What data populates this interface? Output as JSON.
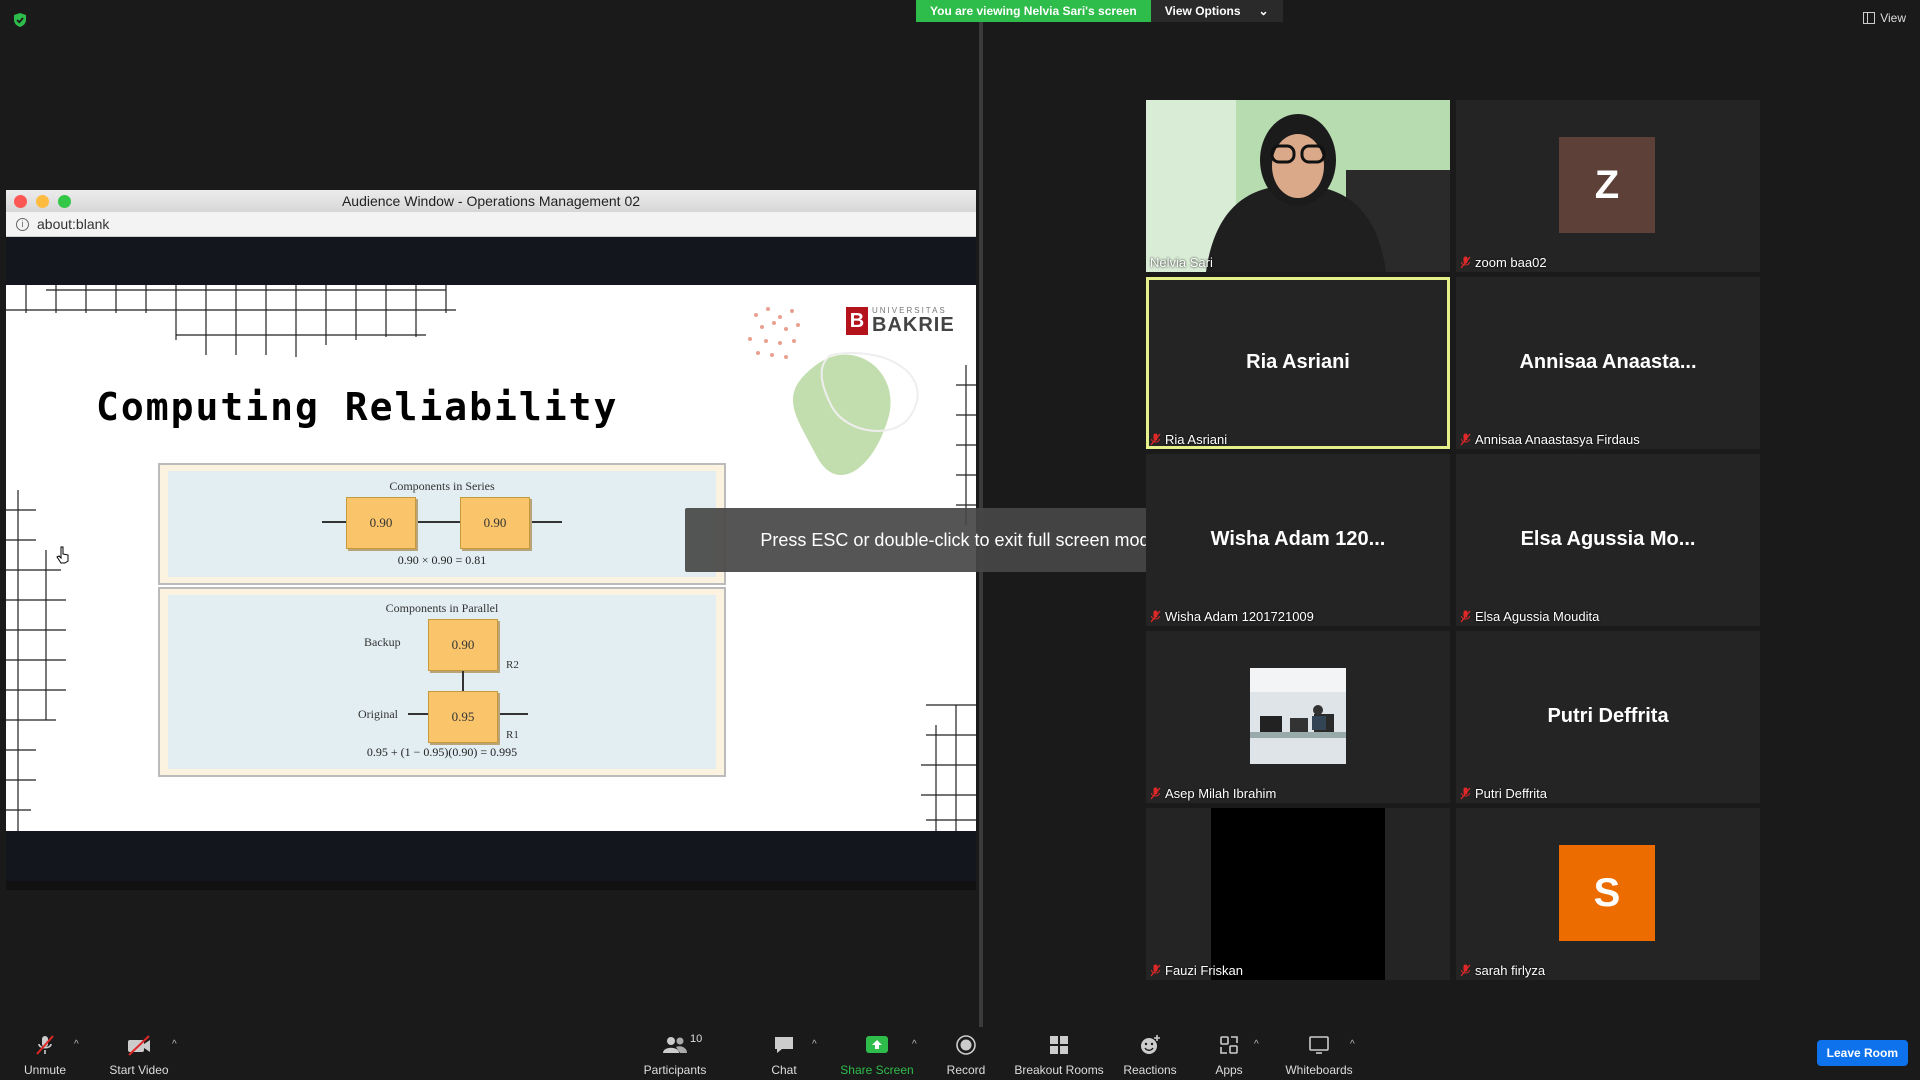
{
  "top": {
    "banner_text": "You are viewing Nelvia Sari's screen",
    "view_options_label": "View Options",
    "view_label": "View"
  },
  "audience_window": {
    "title": "Audience Window - Operations Management 02",
    "url": "about:blank"
  },
  "slide": {
    "title": "Computing Reliability",
    "logo_small": "UNIVERSITAS",
    "logo_big": "BAKRIE",
    "series": {
      "title": "Components in Series",
      "component_1": "0.90",
      "component_2": "0.90",
      "formula": "0.90 × 0.90 = 0.81"
    },
    "parallel": {
      "title": "Components in Parallel",
      "backup_label": "Backup",
      "backup_value": "0.90",
      "backup_r": "R2",
      "original_label": "Original",
      "original_value": "0.95",
      "original_r": "R1",
      "formula": "0.95 + (1 − 0.95)(0.90) = 0.995"
    }
  },
  "esc_toast": "Press ESC or double-click to exit full screen mode",
  "participants": [
    {
      "name": "Nelvia Sari",
      "display": "",
      "type": "video"
    },
    {
      "name": "zoom baa02",
      "display": "Z",
      "type": "avatar",
      "color": "#5d4037"
    },
    {
      "name": "Ria Asriani",
      "display": "Ria Asriani",
      "type": "name",
      "active": true
    },
    {
      "name": "Annisaa Anaastasya Firdaus",
      "display": "Annisaa  Anaasta...",
      "type": "name"
    },
    {
      "name": "Wisha Adam 1201721009",
      "display": "Wisha Adam 120...",
      "type": "name"
    },
    {
      "name": "Elsa Agussia Moudita",
      "display": "Elsa Agussia Mo...",
      "type": "name"
    },
    {
      "name": "Asep Milah Ibrahim",
      "display": "",
      "type": "photo"
    },
    {
      "name": "Putri Deffrita",
      "display": "Putri Deffrita",
      "type": "name"
    },
    {
      "name": "Fauzi Friskan",
      "display": "",
      "type": "black"
    },
    {
      "name": "sarah firlyza",
      "display": "S",
      "type": "avatar",
      "color": "#ec6c00"
    }
  ],
  "toolbar": {
    "unmute": "Unmute",
    "start_video": "Start Video",
    "participants": "Participants",
    "participants_count": "10",
    "chat": "Chat",
    "share_screen": "Share Screen",
    "record": "Record",
    "breakout_rooms": "Breakout Rooms",
    "reactions": "Reactions",
    "apps": "Apps",
    "whiteboards": "Whiteboards",
    "leave_room": "Leave Room"
  },
  "colors": {
    "share_green": "#2ebc4a",
    "active_speaker": "#e6f08a",
    "leave_blue": "#0e72ed",
    "mic_red": "#e02828"
  }
}
